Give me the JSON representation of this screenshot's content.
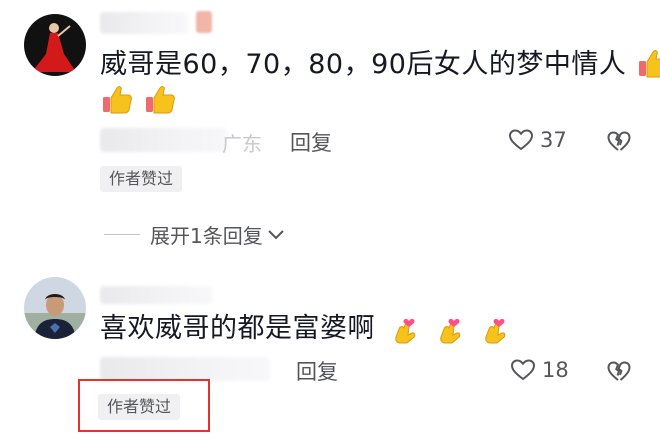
{
  "comments": [
    {
      "text": "威哥是60，70，80，90后女人的梦中情人",
      "location": "广东",
      "reply_label": "回复",
      "like_count": "37",
      "badge": "作者赞过",
      "avatar_icon": "woman-red-dress-avatar",
      "emoji_icon": "thumbs-up-emoji"
    },
    {
      "text": "喜欢威哥的都是富婆啊",
      "reply_label": "回复",
      "like_count": "18",
      "badge": "作者赞过",
      "avatar_icon": "man-avatar",
      "emoji_icon": "finger-heart-emoji"
    }
  ],
  "expand_replies": {
    "label": "展开1条回复"
  },
  "colors": {
    "text_primary": "#161823",
    "text_secondary": "#55565c",
    "badge_bg": "#f0f0f2",
    "highlight": "#e5322d",
    "emoji_yellow": "#f8c21c"
  }
}
